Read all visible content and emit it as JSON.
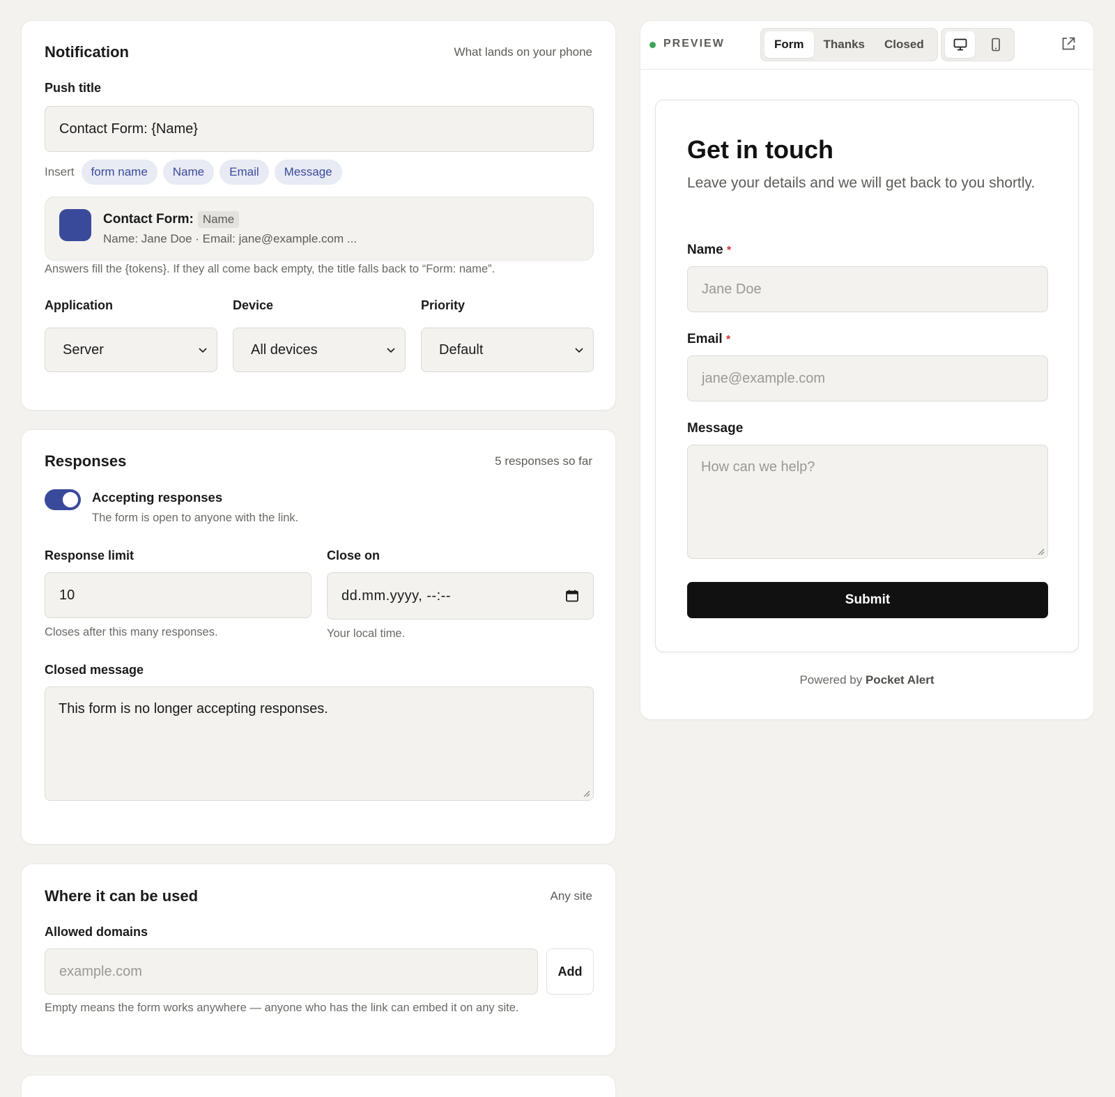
{
  "notification": {
    "title": "Notification",
    "meta": "What lands on your phone",
    "push_title_label": "Push title",
    "push_title_value": "Contact Form: {Name}",
    "insert_label": "Insert",
    "insert_chips": [
      "form name",
      "Name",
      "Email",
      "Message"
    ],
    "preview_title_prefix": "Contact Form:",
    "preview_title_token": "Name",
    "preview_body": "Name: Jane Doe · Email: jane@example.com ...",
    "tokens_hint": "Answers fill the {tokens}. If they all come back empty, the title falls back to “Form: name”.",
    "application_label": "Application",
    "application_value": "Server",
    "device_label": "Device",
    "device_value": "All devices",
    "priority_label": "Priority",
    "priority_value": "Default"
  },
  "responses": {
    "title": "Responses",
    "meta": "5 responses so far",
    "toggle_label": "Accepting responses",
    "toggle_on": true,
    "toggle_desc": "The form is open to anyone with the link.",
    "limit_label": "Response limit",
    "limit_value": "10",
    "limit_hint": "Closes after this many responses.",
    "close_on_label": "Close on",
    "close_on_value": "dd.mm.yyyy, --:--",
    "close_on_hint": "Your local time.",
    "closed_message_label": "Closed message",
    "closed_message_value": "This form is no longer accepting responses."
  },
  "where": {
    "title": "Where it can be used",
    "meta": "Any site",
    "domains_label": "Allowed domains",
    "domains_placeholder": "example.com",
    "add_label": "Add",
    "domains_hint": "Empty means the form works anywhere — anyone who has the link can embed it on any site."
  },
  "preview": {
    "badge": "PREVIEW",
    "tabs": [
      "Form",
      "Thanks",
      "Closed"
    ],
    "active_tab": "Form",
    "form_title": "Get in touch",
    "form_subtitle": "Leave your details and we will get back to you shortly.",
    "name_label": "Name",
    "name_placeholder": "Jane Doe",
    "email_label": "Email",
    "email_placeholder": "jane@example.com",
    "message_label": "Message",
    "message_placeholder": "How can we help?",
    "required_mark": "*",
    "submit_label": "Submit",
    "powered_prefix": "Powered by",
    "powered_brand": "Pocket Alert"
  },
  "icons": [
    "monitor-icon",
    "phone-icon",
    "external-link-icon",
    "chevron-down-icon",
    "calendar-icon"
  ],
  "colors": {
    "accent": "#3a4a9a",
    "toggle_on": "#3a4a9a",
    "live_dot": "#3fa35a",
    "required": "#d93030",
    "submit_bg": "#111111"
  }
}
